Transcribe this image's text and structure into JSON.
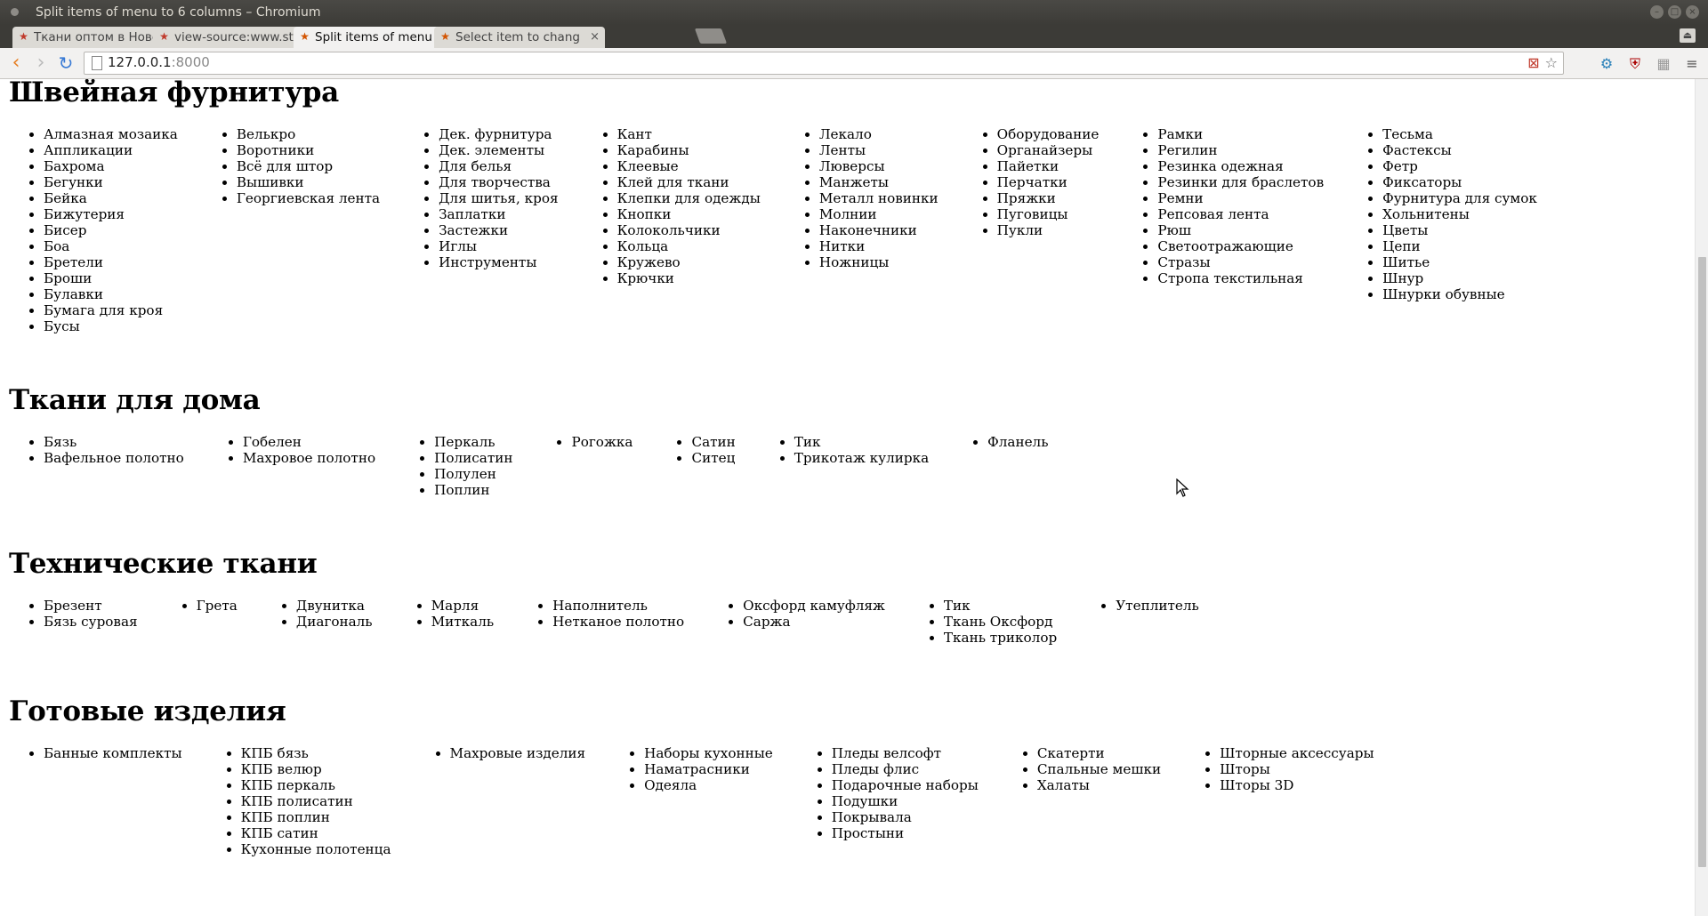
{
  "window": {
    "title": "Split items of menu to 6 columns – Chromium",
    "controls": [
      "–",
      "□",
      "×"
    ]
  },
  "tabs": [
    {
      "label": "Ткани оптом в Новс",
      "icon": "star-favicon-icon"
    },
    {
      "label": "view-source:www.st",
      "icon": "star-favicon-icon"
    },
    {
      "label": "Split items of menu",
      "icon": "django-favicon-icon"
    },
    {
      "label": "Select item to chang",
      "icon": "django-favicon-icon"
    }
  ],
  "toolbar": {
    "back": "‹",
    "forward": "›",
    "reload": "↻",
    "url_host": "127.0.0.1",
    "url_port": ":8000",
    "icons": [
      "blocked-icon",
      "bookmark-star-icon",
      "extension-icon",
      "ublock-icon",
      "qr-icon",
      "menu-icon"
    ]
  },
  "sections": [
    {
      "title": "Швейная фурнитура",
      "columns": [
        [
          "Алмазная мозаика",
          "Аппликации",
          "Бахрома",
          "Бегунки",
          "Бейка",
          "Бижутерия",
          "Бисер",
          "Боа",
          "Бретели",
          "Броши",
          "Булавки",
          "Бумага для кроя",
          "Бусы"
        ],
        [
          "Велькро",
          "Воротники",
          "Всё для штор",
          "Вышивки",
          "Георгиевская лента"
        ],
        [
          "Дек. фурнитура",
          "Дек. элементы",
          "Для белья",
          "Для творчества",
          "Для шитья, кроя",
          "Заплатки",
          "Застежки",
          "Иглы",
          "Инструменты"
        ],
        [
          "Кант",
          "Карабины",
          "Клеевые",
          "Клей для ткани",
          "Клепки для одежды",
          "Кнопки",
          "Колокольчики",
          "Кольца",
          "Кружево",
          "Крючки"
        ],
        [
          "Лекало",
          "Ленты",
          "Люверсы",
          "Манжеты",
          "Металл новинки",
          "Молнии",
          "Наконечники",
          "Нитки",
          "Ножницы"
        ],
        [
          "Оборудование",
          "Органайзеры",
          "Пайетки",
          "Перчатки",
          "Пряжки",
          "Пуговицы",
          "Пукли"
        ],
        [
          "Рамки",
          "Регилин",
          "Резинка одежная",
          "Резинки для браслетов",
          "Ремни",
          "Репсовая лента",
          "Рюш",
          "Светоотражающие",
          "Стразы",
          "Стропа текстильная"
        ],
        [
          "Тесьма",
          "Фастексы",
          "Фетр",
          "Фиксаторы",
          "Фурнитура для сумок",
          "Хольнитены",
          "Цветы",
          "Цепи",
          "Шитье",
          "Шнур",
          "Шнурки обувные"
        ]
      ]
    },
    {
      "title": "Ткани для дома",
      "columns": [
        [
          "Бязь",
          "Вафельное полотно"
        ],
        [
          "Гобелен",
          "Махровое полотно"
        ],
        [
          "Перкаль",
          "Полисатин",
          "Полулен",
          "Поплин"
        ],
        [
          "Рогожка"
        ],
        [
          "Сатин",
          "Ситец"
        ],
        [
          "Тик",
          "Трикотаж кулирка"
        ],
        [
          "Фланель"
        ]
      ]
    },
    {
      "title": "Технические ткани",
      "columns": [
        [
          "Брезент",
          "Бязь суровая"
        ],
        [
          "Грета"
        ],
        [
          "Двунитка",
          "Диагональ"
        ],
        [
          "Марля",
          "Миткаль"
        ],
        [
          "Наполнитель",
          "Нетканое полотно"
        ],
        [
          "Оксфорд камуфляж",
          "Саржа"
        ],
        [
          "Тик",
          "Ткань Оксфорд",
          "Ткань триколор"
        ],
        [
          "Утеплитель"
        ]
      ]
    },
    {
      "title": "Готовые изделия",
      "columns": [
        [
          "Банные комплекты"
        ],
        [
          "КПБ бязь",
          "КПБ велюр",
          "КПБ перкаль",
          "КПБ полисатин",
          "КПБ поплин",
          "КПБ сатин",
          "Кухонные полотенца"
        ],
        [
          "Махровые изделия"
        ],
        [
          "Наборы кухонные",
          "Наматрасники",
          "Одеяла"
        ],
        [
          "Пледы велсофт",
          "Пледы флис",
          "Подарочные наборы",
          "Подушки",
          "Покрывала",
          "Простыни"
        ],
        [
          "Скатерти",
          "Спальные мешки",
          "Халаты"
        ],
        [
          "Шторные аксессуары",
          "Шторы",
          "Шторы 3D"
        ]
      ]
    }
  ]
}
